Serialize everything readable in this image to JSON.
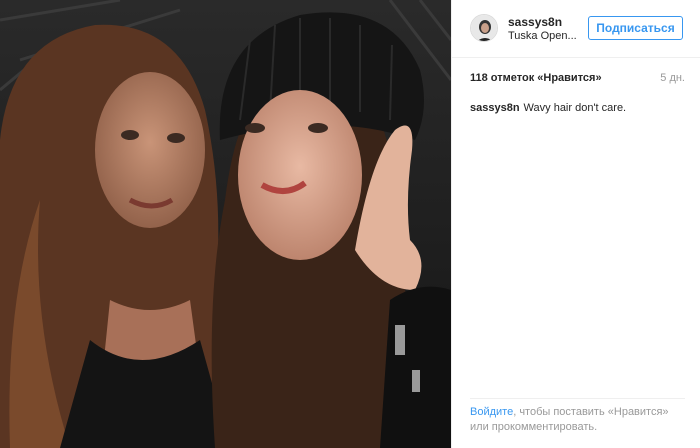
{
  "post": {
    "username": "sassys8n",
    "location": "Tuska Open...",
    "follow_label": "Подписаться",
    "likes": "118 отметок «Нравится»",
    "time_ago": "5 дн.",
    "caption_user": "sassys8n",
    "caption_text": "Wavy hair don't care.",
    "footer_login": "Войдите",
    "footer_rest": ", чтобы поставить «Нравится» или прокомментировать."
  },
  "colors": {
    "accent": "#3897f0",
    "muted": "#999999",
    "text": "#262626"
  }
}
